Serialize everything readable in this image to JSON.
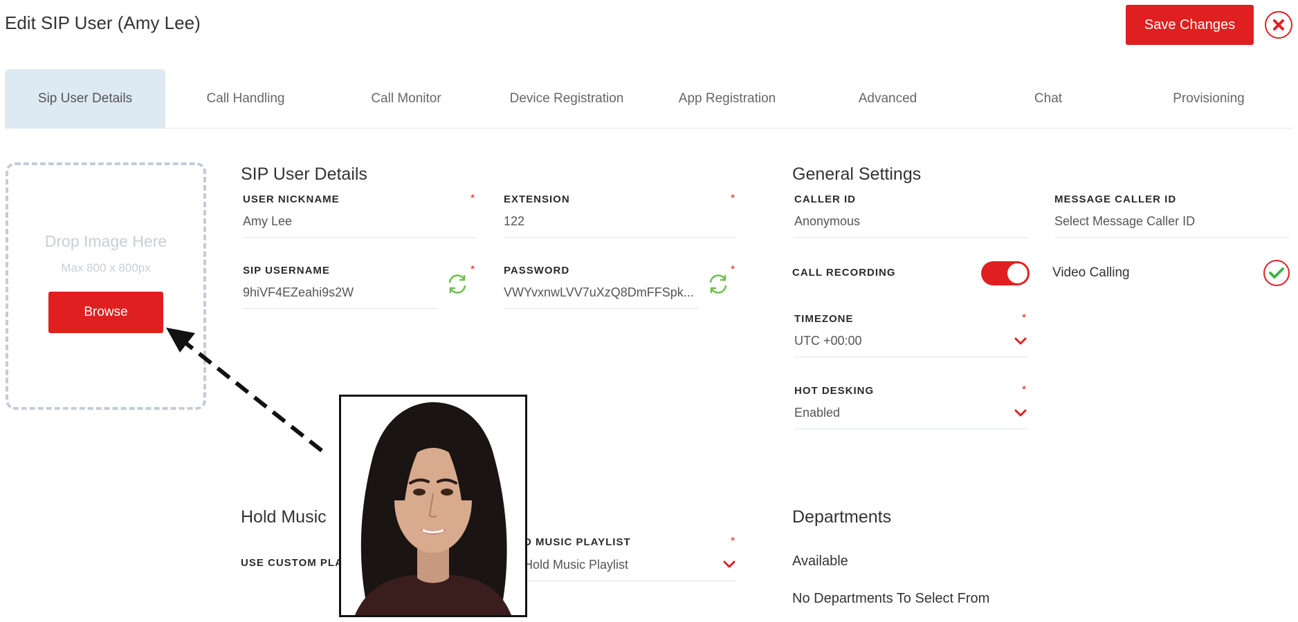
{
  "header": {
    "title": "Edit SIP User (Amy Lee)",
    "save_label": "Save Changes",
    "close_icon": "close-x-icon"
  },
  "tabs": [
    {
      "label": "Sip User Details",
      "active": true
    },
    {
      "label": "Call Handling"
    },
    {
      "label": "Call Monitor"
    },
    {
      "label": "Device Registration"
    },
    {
      "label": "App Registration"
    },
    {
      "label": "Advanced"
    },
    {
      "label": "Chat"
    },
    {
      "label": "Provisioning"
    }
  ],
  "dropzone": {
    "title": "Drop Image Here",
    "subtitle": "Max 800 x 800px",
    "browse_label": "Browse"
  },
  "sip_user_details": {
    "title": "SIP User Details",
    "nickname": {
      "label": "USER NICKNAME",
      "value": "Amy Lee",
      "required": "*"
    },
    "extension": {
      "label": "EXTENSION",
      "value": "122",
      "required": "*"
    },
    "sip_username": {
      "label": "SIP USERNAME",
      "value": "9hiVF4EZeahi9s2W",
      "required": "*"
    },
    "password": {
      "label": "PASSWORD",
      "value": "VWYvxnwLVV7uXzQ8DmFFSpk...",
      "required": "*"
    }
  },
  "general_settings": {
    "title": "General Settings",
    "caller_id": {
      "label": "CALLER ID",
      "value": "Anonymous"
    },
    "message_caller_id": {
      "label": "MESSAGE CALLER ID",
      "value": "Select Message Caller ID"
    },
    "call_recording": {
      "label": "CALL RECORDING",
      "enabled": true
    },
    "video_calling": {
      "label": "Video Calling",
      "checked": true
    },
    "timezone": {
      "label": "TIMEZONE",
      "value": "UTC +00:00",
      "required": "*"
    },
    "hot_desking": {
      "label": "HOT DESKING",
      "value": "Enabled",
      "required": "*"
    }
  },
  "hold_music": {
    "title": "Hold Music",
    "use_custom_label": "USE CUSTOM PLA",
    "playlist_label": "D MUSIC PLAYLIST",
    "playlist_value": "Hold Music Playlist",
    "required": "*"
  },
  "departments": {
    "title": "Departments",
    "available_label": "Available",
    "empty_text": "No Departments To Select From"
  },
  "colors": {
    "accent": "#e02020",
    "active_tab_bg": "#dde9f3",
    "refresh_green": "#6cc04a",
    "check_green": "#3bb54a"
  },
  "icons": {
    "refresh": "refresh-icon",
    "chevron": "chevron-down-icon",
    "check": "check-icon",
    "arrow": "dashed-arrow-icon"
  }
}
